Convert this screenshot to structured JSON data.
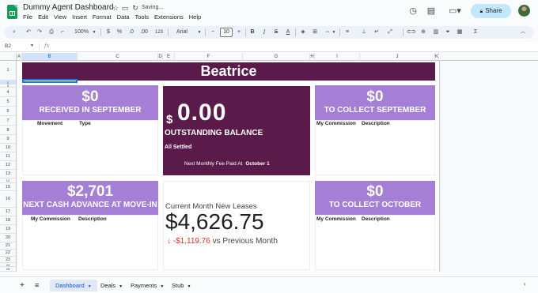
{
  "app": {
    "title": "Dummy Agent Dashboard",
    "status": "Saving...",
    "menus": [
      "File",
      "Edit",
      "View",
      "Insert",
      "Format",
      "Data",
      "Tools",
      "Extensions",
      "Help"
    ],
    "share_label": "Share",
    "icons": [
      "sheets-logo-icon",
      "star-icon",
      "folder-move-icon",
      "cloud-sync-icon",
      "history-icon",
      "comment-icon",
      "video-icon",
      "lock-icon"
    ]
  },
  "toolbar": {
    "zoom": "100%",
    "currency": "$",
    "percent": "%",
    "decrease_decimal": ".0",
    "increase_decimal": ".00",
    "format_123": "123",
    "font": "Arial",
    "font_size": "10",
    "minus": "−",
    "plus": "+",
    "bold": "B",
    "italic": "I",
    "strike": "S",
    "text_color": "A",
    "functions": "Σ"
  },
  "formula_bar": {
    "name_box": "B2",
    "fx": "fx",
    "value": ""
  },
  "grid": {
    "columns": [
      "A",
      "B",
      "C",
      "D",
      "E",
      "F",
      "G",
      "H",
      "I",
      "J",
      "K"
    ],
    "selected_column": "B",
    "rows": [
      "1",
      "2",
      "3",
      "4",
      "5",
      "6",
      "7",
      "8",
      "9",
      "10",
      "11",
      "12",
      "13",
      "14",
      "15",
      "16",
      "17",
      "18",
      "19",
      "20",
      "21",
      "22",
      "23",
      "24",
      "25",
      "26",
      "27"
    ],
    "selected_row": "2"
  },
  "dashboard": {
    "name": "Beatrice",
    "received": {
      "amount": "$0",
      "label": "RECEIVED IN SEPTEMBER",
      "col1": "Movement",
      "col2": "Type"
    },
    "outstanding": {
      "currency": "$",
      "amount": "0.00",
      "label": "OUTSTANDING BALANCE",
      "status": "All Settled",
      "next_fee_label": "Next Monthly Fee Paid At",
      "next_fee_date": "October 1"
    },
    "collect_september": {
      "amount": "$0",
      "label": "TO COLLECT SEPTEMBER",
      "col1": "My Commission",
      "col2": "Description"
    },
    "cash_advance": {
      "amount": "$2,701",
      "label": "NEXT CASH ADVANCE AT MOVE-IN",
      "col1": "My Commission",
      "col2": "Description"
    },
    "leases": {
      "title": "Current Month New Leases",
      "amount": "$4,626.75",
      "delta": "-$1,119.76",
      "delta_suffix": "vs Previous Month"
    },
    "collect_october": {
      "amount": "$0",
      "label": "TO COLLECT OCTOBER",
      "col1": "My Commission",
      "col2": "Description"
    }
  },
  "sheets": {
    "tabs": [
      "Dashboard",
      "Deals",
      "Payments",
      "Stub"
    ],
    "active": "Dashboard"
  },
  "colors": {
    "banner": "#5a1a4a",
    "card": "#a57fd6",
    "share": "#c2e7ff",
    "negative": "#d93025"
  }
}
